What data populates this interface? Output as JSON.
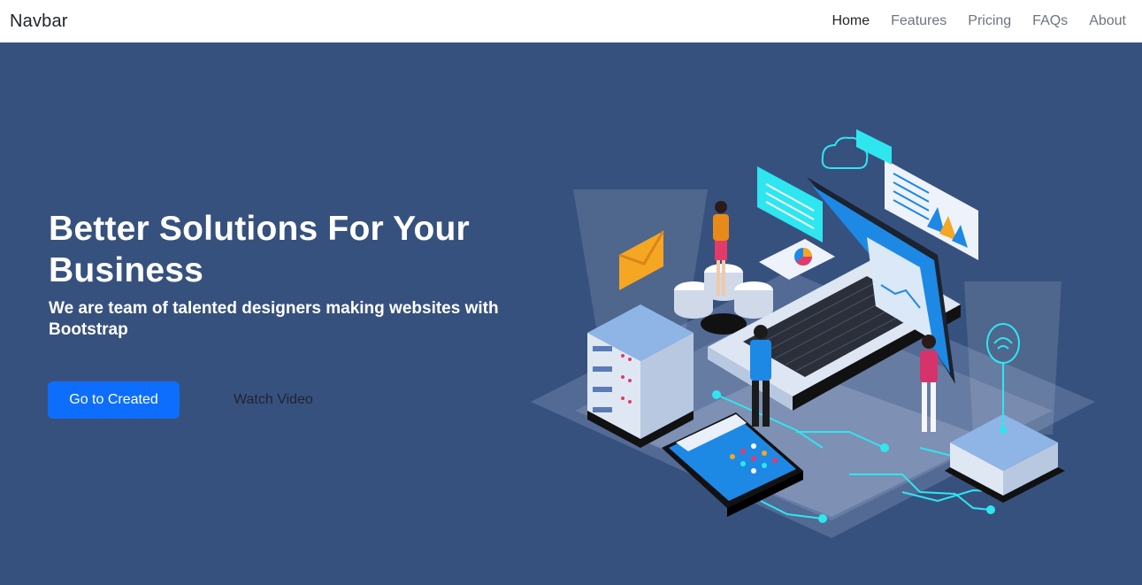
{
  "navbar": {
    "brand": "Navbar",
    "links": [
      {
        "label": "Home",
        "active": true
      },
      {
        "label": "Features",
        "active": false
      },
      {
        "label": "Pricing",
        "active": false
      },
      {
        "label": "FAQs",
        "active": false
      },
      {
        "label": "About",
        "active": false
      }
    ]
  },
  "hero": {
    "title": "Better Solutions For Your Business",
    "subtitle": "We are team of talented designers making websites with Bootstrap",
    "primary_button": "Go to Created",
    "secondary_button": "Watch Video",
    "illustration": "isometric-tech-illustration"
  },
  "colors": {
    "hero_background": "#37517e",
    "primary": "#0d6efd",
    "navbar_background": "#ffffff",
    "accent_cyan": "#2ee6f0"
  }
}
